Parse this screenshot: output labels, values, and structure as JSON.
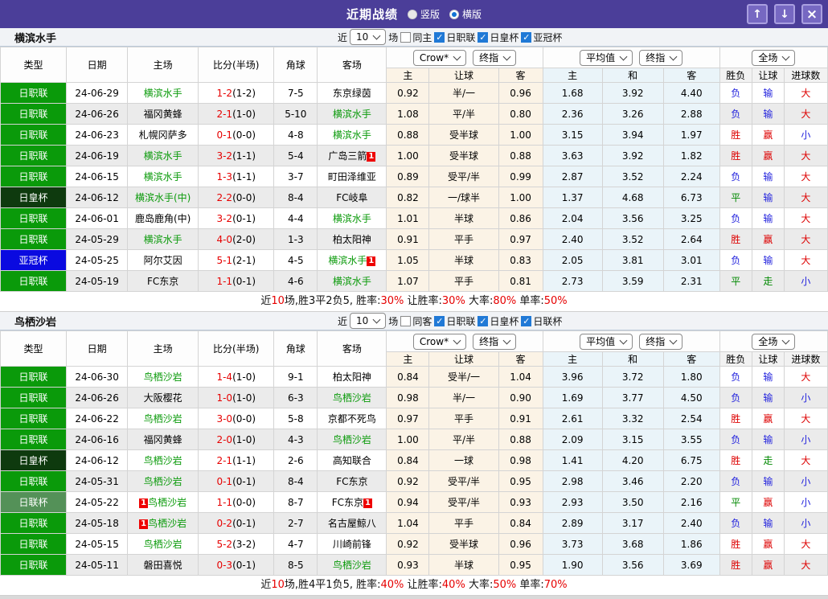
{
  "titlebar": {
    "title": "近期战绩",
    "radios": [
      {
        "label": "竖版",
        "selected": false
      },
      {
        "label": "横版",
        "selected": true
      }
    ],
    "buttons": {
      "up": "↑",
      "down": "↓",
      "close": "×"
    }
  },
  "columns": {
    "type": "类型",
    "date": "日期",
    "home": "主场",
    "score": "比分(半场)",
    "corners": "角球",
    "away": "客场",
    "asia": [
      "主",
      "让球",
      "客"
    ],
    "europe": [
      "主",
      "和",
      "客"
    ],
    "result": [
      "胜负",
      "让球",
      "进球数"
    ]
  },
  "type_colors": {
    "日职联": "#0a9a0a",
    "日皇杯": "#0e3a0e",
    "亚冠杯": "#0a0ae0",
    "日联杯": "#549158"
  },
  "accent_colors": {
    "win_red": "#dd0000",
    "lose_blue": "#2222dd",
    "draw_green": "#008800",
    "team_green": "#0a9a0a",
    "score_red": "#e60000",
    "titlebar_purple": "#4b3e99"
  },
  "sections": [
    {
      "team": "横滨水手",
      "controls": {
        "near": "近",
        "games": "10",
        "suffix": "场",
        "same": {
          "label": "同主",
          "checked": false
        },
        "comps": [
          {
            "label": "日职联",
            "checked": true
          },
          {
            "label": "日皇杯",
            "checked": true
          },
          {
            "label": "亚冠杯",
            "checked": true
          }
        ]
      },
      "selects": {
        "company": "Crow*",
        "asia_final": "终指",
        "average": "平均值",
        "euro_final": "终指",
        "scope": "全场"
      },
      "rows": [
        {
          "type": "日职联",
          "date": "24-06-29",
          "home": {
            "name": "横滨水手",
            "hl": true
          },
          "score": "1-2",
          "half": "(1-2)",
          "corners": "7-5",
          "away": {
            "name": "东京绿茵",
            "hl": false
          },
          "asia": [
            "0.92",
            "半/一",
            "0.96"
          ],
          "europe": [
            "1.68",
            "3.92",
            "4.40"
          ],
          "result": [
            "负",
            "输",
            "大"
          ]
        },
        {
          "type": "日职联",
          "date": "24-06-26",
          "home": {
            "name": "福冈黄蜂",
            "hl": false
          },
          "score": "2-1",
          "half": "(1-0)",
          "corners": "5-10",
          "away": {
            "name": "横滨水手",
            "hl": true
          },
          "asia": [
            "1.08",
            "平/半",
            "0.80"
          ],
          "europe": [
            "2.36",
            "3.26",
            "2.88"
          ],
          "result": [
            "负",
            "输",
            "大"
          ]
        },
        {
          "type": "日职联",
          "date": "24-06-23",
          "home": {
            "name": "札幌冈萨多",
            "hl": false
          },
          "score": "0-1",
          "half": "(0-0)",
          "corners": "4-8",
          "away": {
            "name": "横滨水手",
            "hl": true
          },
          "asia": [
            "0.88",
            "受半球",
            "1.00"
          ],
          "europe": [
            "3.15",
            "3.94",
            "1.97"
          ],
          "result": [
            "胜",
            "赢",
            "小"
          ]
        },
        {
          "type": "日职联",
          "date": "24-06-19",
          "home": {
            "name": "横滨水手",
            "hl": true
          },
          "score": "3-2",
          "half": "(1-1)",
          "corners": "5-4",
          "away": {
            "name": "广岛三箭",
            "hl": false,
            "card_after": "1"
          },
          "asia": [
            "1.00",
            "受半球",
            "0.88"
          ],
          "europe": [
            "3.63",
            "3.92",
            "1.82"
          ],
          "result": [
            "胜",
            "赢",
            "大"
          ]
        },
        {
          "type": "日职联",
          "date": "24-06-15",
          "home": {
            "name": "横滨水手",
            "hl": true
          },
          "score": "1-3",
          "half": "(1-1)",
          "corners": "3-7",
          "away": {
            "name": "町田泽维亚",
            "hl": false
          },
          "asia": [
            "0.89",
            "受平/半",
            "0.99"
          ],
          "europe": [
            "2.87",
            "3.52",
            "2.24"
          ],
          "result": [
            "负",
            "输",
            "大"
          ]
        },
        {
          "type": "日皇杯",
          "date": "24-06-12",
          "home": {
            "name": "横滨水手(中)",
            "hl": true
          },
          "score": "2-2",
          "half": "(0-0)",
          "corners": "8-4",
          "away": {
            "name": "FC岐阜",
            "hl": false
          },
          "asia": [
            "0.82",
            "一/球半",
            "1.00"
          ],
          "europe": [
            "1.37",
            "4.68",
            "6.73"
          ],
          "result": [
            "平",
            "输",
            "大"
          ]
        },
        {
          "type": "日职联",
          "date": "24-06-01",
          "home": {
            "name": "鹿岛鹿角(中)",
            "hl": false
          },
          "score": "3-2",
          "half": "(0-1)",
          "corners": "4-4",
          "away": {
            "name": "横滨水手",
            "hl": true
          },
          "asia": [
            "1.01",
            "半球",
            "0.86"
          ],
          "europe": [
            "2.04",
            "3.56",
            "3.25"
          ],
          "result": [
            "负",
            "输",
            "大"
          ]
        },
        {
          "type": "日职联",
          "date": "24-05-29",
          "home": {
            "name": "横滨水手",
            "hl": true
          },
          "score": "4-0",
          "half": "(2-0)",
          "corners": "1-3",
          "away": {
            "name": "柏太阳神",
            "hl": false
          },
          "asia": [
            "0.91",
            "平手",
            "0.97"
          ],
          "europe": [
            "2.40",
            "3.52",
            "2.64"
          ],
          "result": [
            "胜",
            "赢",
            "大"
          ]
        },
        {
          "type": "亚冠杯",
          "date": "24-05-25",
          "home": {
            "name": "阿尔艾因",
            "hl": false
          },
          "score": "5-1",
          "half": "(2-1)",
          "corners": "4-5",
          "away": {
            "name": "横滨水手",
            "hl": true,
            "card_after": "1"
          },
          "asia": [
            "1.05",
            "半球",
            "0.83"
          ],
          "europe": [
            "2.05",
            "3.81",
            "3.01"
          ],
          "result": [
            "负",
            "输",
            "大"
          ]
        },
        {
          "type": "日职联",
          "date": "24-05-19",
          "home": {
            "name": "FC东京",
            "hl": false
          },
          "score": "1-1",
          "half": "(0-1)",
          "corners": "4-6",
          "away": {
            "name": "横滨水手",
            "hl": true
          },
          "asia": [
            "1.07",
            "平手",
            "0.81"
          ],
          "europe": [
            "2.73",
            "3.59",
            "2.31"
          ],
          "result": [
            "平",
            "走",
            "小"
          ]
        }
      ],
      "summary": [
        [
          "近",
          "k"
        ],
        [
          "10",
          "r"
        ],
        [
          "场,胜3平2负5, 胜率:",
          "k"
        ],
        [
          "30%",
          "r"
        ],
        [
          " 让胜率:",
          "k"
        ],
        [
          "30%",
          "r"
        ],
        [
          " 大率:",
          "k"
        ],
        [
          "80%",
          "r"
        ],
        [
          " 单率:",
          "k"
        ],
        [
          "50%",
          "r"
        ]
      ]
    },
    {
      "team": "鸟栖沙岩",
      "controls": {
        "near": "近",
        "games": "10",
        "suffix": "场",
        "same": {
          "label": "同客",
          "checked": false
        },
        "comps": [
          {
            "label": "日职联",
            "checked": true
          },
          {
            "label": "日皇杯",
            "checked": true
          },
          {
            "label": "日联杯",
            "checked": true
          }
        ]
      },
      "selects": {
        "company": "Crow*",
        "asia_final": "终指",
        "average": "平均值",
        "euro_final": "终指",
        "scope": "全场"
      },
      "rows": [
        {
          "type": "日职联",
          "date": "24-06-30",
          "home": {
            "name": "鸟栖沙岩",
            "hl": true
          },
          "score": "1-4",
          "half": "(1-0)",
          "corners": "9-1",
          "away": {
            "name": "柏太阳神",
            "hl": false
          },
          "asia": [
            "0.84",
            "受半/一",
            "1.04"
          ],
          "europe": [
            "3.96",
            "3.72",
            "1.80"
          ],
          "result": [
            "负",
            "输",
            "大"
          ]
        },
        {
          "type": "日职联",
          "date": "24-06-26",
          "home": {
            "name": "大阪樱花",
            "hl": false
          },
          "score": "1-0",
          "half": "(1-0)",
          "corners": "6-3",
          "away": {
            "name": "鸟栖沙岩",
            "hl": true
          },
          "asia": [
            "0.98",
            "半/一",
            "0.90"
          ],
          "europe": [
            "1.69",
            "3.77",
            "4.50"
          ],
          "result": [
            "负",
            "输",
            "小"
          ]
        },
        {
          "type": "日职联",
          "date": "24-06-22",
          "home": {
            "name": "鸟栖沙岩",
            "hl": true
          },
          "score": "3-0",
          "half": "(0-0)",
          "corners": "5-8",
          "away": {
            "name": "京都不死鸟",
            "hl": false
          },
          "asia": [
            "0.97",
            "平手",
            "0.91"
          ],
          "europe": [
            "2.61",
            "3.32",
            "2.54"
          ],
          "result": [
            "胜",
            "赢",
            "大"
          ]
        },
        {
          "type": "日职联",
          "date": "24-06-16",
          "home": {
            "name": "福冈黄蜂",
            "hl": false
          },
          "score": "2-0",
          "half": "(1-0)",
          "corners": "4-3",
          "away": {
            "name": "鸟栖沙岩",
            "hl": true
          },
          "asia": [
            "1.00",
            "平/半",
            "0.88"
          ],
          "europe": [
            "2.09",
            "3.15",
            "3.55"
          ],
          "result": [
            "负",
            "输",
            "小"
          ]
        },
        {
          "type": "日皇杯",
          "date": "24-06-12",
          "home": {
            "name": "鸟栖沙岩",
            "hl": true
          },
          "score": "2-1",
          "half": "(1-1)",
          "corners": "2-6",
          "away": {
            "name": "高知联合",
            "hl": false
          },
          "asia": [
            "0.84",
            "一球",
            "0.98"
          ],
          "europe": [
            "1.41",
            "4.20",
            "6.75"
          ],
          "result": [
            "胜",
            "走",
            "大"
          ]
        },
        {
          "type": "日职联",
          "date": "24-05-31",
          "home": {
            "name": "鸟栖沙岩",
            "hl": true
          },
          "score": "0-1",
          "half": "(0-1)",
          "corners": "8-4",
          "away": {
            "name": "FC东京",
            "hl": false
          },
          "asia": [
            "0.92",
            "受平/半",
            "0.95"
          ],
          "europe": [
            "2.98",
            "3.46",
            "2.20"
          ],
          "result": [
            "负",
            "输",
            "小"
          ]
        },
        {
          "type": "日联杯",
          "date": "24-05-22",
          "home": {
            "name": "鸟栖沙岩",
            "hl": true,
            "card_before": "1"
          },
          "score": "1-1",
          "half": "(0-0)",
          "corners": "8-7",
          "away": {
            "name": "FC东京",
            "hl": false,
            "card_after": "1"
          },
          "asia": [
            "0.94",
            "受平/半",
            "0.93"
          ],
          "europe": [
            "2.93",
            "3.50",
            "2.16"
          ],
          "result": [
            "平",
            "赢",
            "小"
          ]
        },
        {
          "type": "日职联",
          "date": "24-05-18",
          "home": {
            "name": "鸟栖沙岩",
            "hl": true,
            "card_before": "1"
          },
          "score": "0-2",
          "half": "(0-1)",
          "corners": "2-7",
          "away": {
            "name": "名古屋鲸八",
            "hl": false
          },
          "asia": [
            "1.04",
            "平手",
            "0.84"
          ],
          "europe": [
            "2.89",
            "3.17",
            "2.40"
          ],
          "result": [
            "负",
            "输",
            "小"
          ]
        },
        {
          "type": "日职联",
          "date": "24-05-15",
          "home": {
            "name": "鸟栖沙岩",
            "hl": true
          },
          "score": "5-2",
          "half": "(3-2)",
          "corners": "4-7",
          "away": {
            "name": "川崎前锋",
            "hl": false
          },
          "asia": [
            "0.92",
            "受半球",
            "0.96"
          ],
          "europe": [
            "3.73",
            "3.68",
            "1.86"
          ],
          "result": [
            "胜",
            "赢",
            "大"
          ]
        },
        {
          "type": "日职联",
          "date": "24-05-11",
          "home": {
            "name": "磐田喜悦",
            "hl": false
          },
          "score": "0-3",
          "half": "(0-1)",
          "corners": "8-5",
          "away": {
            "name": "鸟栖沙岩",
            "hl": true
          },
          "asia": [
            "0.93",
            "半球",
            "0.95"
          ],
          "europe": [
            "1.90",
            "3.56",
            "3.69"
          ],
          "result": [
            "胜",
            "赢",
            "大"
          ]
        }
      ],
      "summary": [
        [
          "近",
          "k"
        ],
        [
          "10",
          "r"
        ],
        [
          "场,胜4平1负5, 胜率:",
          "k"
        ],
        [
          "40%",
          "r"
        ],
        [
          " 让胜率:",
          "k"
        ],
        [
          "40%",
          "r"
        ],
        [
          " 大率:",
          "k"
        ],
        [
          "50%",
          "r"
        ],
        [
          " 单率:",
          "k"
        ],
        [
          "70%",
          "r"
        ]
      ]
    }
  ]
}
